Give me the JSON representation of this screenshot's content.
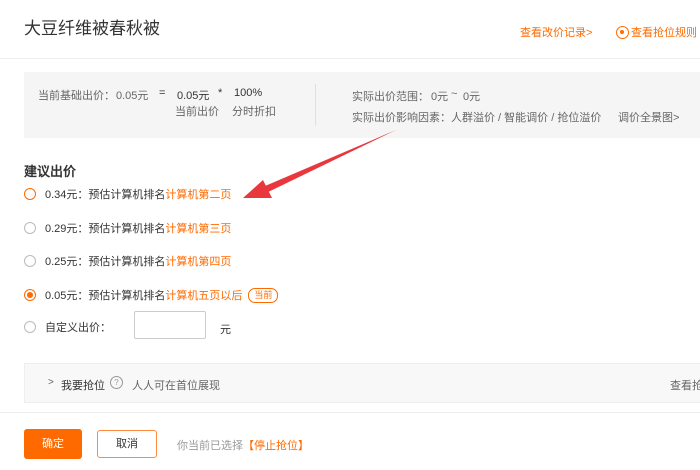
{
  "header": {
    "title": "大豆纤维被春秋被",
    "history_link": "查看改价记录>",
    "rules_link": "查看抢位规则"
  },
  "info": {
    "base_price_label": "当前基础出价：",
    "base_price_value": "0.05元",
    "eq": "=",
    "current_bid_value": "0.05元",
    "times": "*",
    "discount_value": "100%",
    "current_bid_caption": "当前出价",
    "discount_caption": "分时折扣",
    "range_label": "实际出价范围：",
    "range_from": "0元",
    "range_sep": "~",
    "range_to": "0元",
    "factors_text": "实际出价影响因素：人群溢价 / 智能调价 / 抢位溢价",
    "factors_link": "调价全景图>"
  },
  "suggest": {
    "title": "建议出价",
    "options": [
      {
        "price": "0.34元：",
        "desc": "预估计算机排名",
        "rank": "计算机第二页",
        "selected": false
      },
      {
        "price": "0.29元：",
        "desc": "预估计算机排名",
        "rank": "计算机第三页",
        "selected": false
      },
      {
        "price": "0.25元：",
        "desc": "预估计算机排名",
        "rank": "计算机第四页",
        "selected": false
      },
      {
        "price": "0.05元：",
        "desc": "预估计算机排名",
        "rank": "计算机五页以后",
        "selected": true,
        "badge": "当前"
      }
    ],
    "custom_label": "自定义出价：",
    "custom_value": "",
    "custom_unit": "元"
  },
  "snag": {
    "title": "我要抢位",
    "help": "?",
    "desc": "人人可在首位展现",
    "link": "查看抢"
  },
  "footer": {
    "ok_label": "确定",
    "cancel_label": "取消",
    "status_text": "你当前已选择",
    "status_value": "【停止抢位】"
  },
  "colors": {
    "accent": "#ff6a00",
    "arrow": "#e8383d"
  }
}
